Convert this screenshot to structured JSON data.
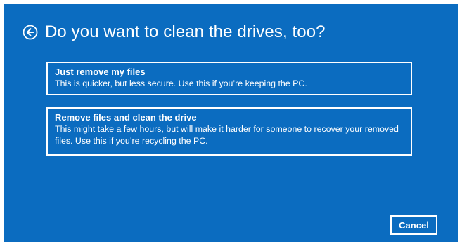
{
  "page": {
    "title": "Do you want to clean the drives, too?"
  },
  "icons": {
    "back": "back-arrow-circle-icon"
  },
  "options": [
    {
      "title": "Just remove my files",
      "description": "This is quicker, but less secure. Use this if you’re keeping the PC."
    },
    {
      "title": "Remove files and clean the drive",
      "description": "This might take a few hours, but will make it harder for someone to recover your removed files. Use this if you’re recycling the PC."
    }
  ],
  "buttons": {
    "cancel": "Cancel"
  },
  "colors": {
    "background": "#0b6cc0",
    "foreground": "#ffffff"
  }
}
